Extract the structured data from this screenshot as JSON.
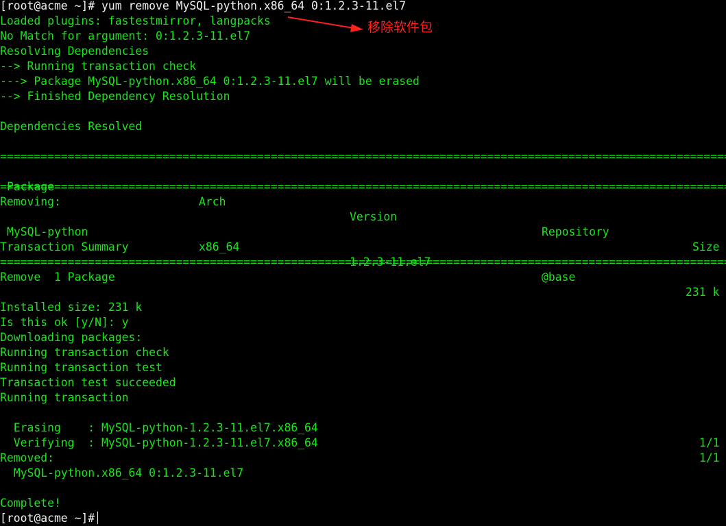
{
  "prompt": "[root@acme ~]#",
  "command": "yum remove MySQL-python.x86_64 0:1.2.3-11.el7",
  "annotation": "移除软件包",
  "output": {
    "loaded_plugins": "Loaded plugins: fastestmirror, langpacks",
    "no_match": "No Match for argument: 0:1.2.3-11.el7",
    "resolving": "Resolving Dependencies",
    "running_check": "--> Running transaction check",
    "package_erased": "---> Package MySQL-python.x86_64 0:1.2.3-11.el7 will be erased",
    "finished_resolution": "--> Finished Dependency Resolution",
    "deps_resolved": "Dependencies Resolved",
    "separator": "==========================================================================================================================",
    "table": {
      "headers": [
        "Package",
        "Arch",
        "Version",
        "Repository",
        "Size"
      ],
      "section": "Removing:",
      "rows": [
        [
          "MySQL-python",
          "x86_64",
          "1.2.3-11.el7",
          "@base",
          "231 k"
        ]
      ]
    },
    "transaction_summary": "Transaction Summary",
    "remove_count": "Remove  1 Package",
    "installed_size": "Installed size: 231 k",
    "confirm": "Is this ok [y/N]: y",
    "downloading": "Downloading packages:",
    "running_tx_check": "Running transaction check",
    "running_tx_test": "Running transaction test",
    "tx_test_succeeded": "Transaction test succeeded",
    "running_tx": "Running transaction",
    "steps": [
      {
        "action": "  Erasing    : MySQL-python-1.2.3-11.el7.x86_64",
        "progress": "1/1"
      },
      {
        "action": "  Verifying  : MySQL-python-1.2.3-11.el7.x86_64",
        "progress": "1/1"
      }
    ],
    "removed_label": "Removed:",
    "removed_pkg": "  MySQL-python.x86_64 0:1.2.3-11.el7",
    "complete": "Complete!"
  },
  "colors": {
    "background": "#000000",
    "output_text": "#17e617",
    "command_text": "#f2f2f2",
    "annotation": "#ff2020"
  }
}
